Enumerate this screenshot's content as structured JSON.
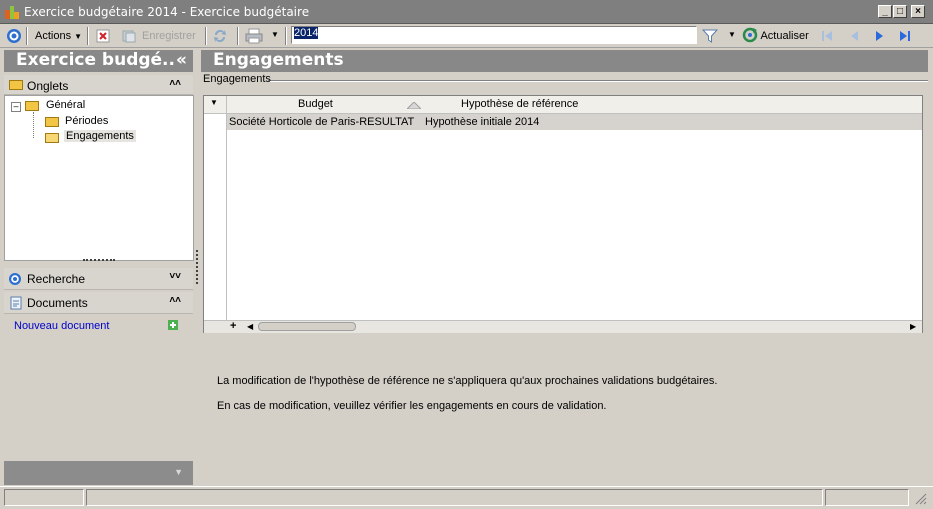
{
  "window": {
    "title": "Exercice budgétaire 2014 -  Exercice budgétaire",
    "minimize": "_",
    "maximize": "□",
    "close": "×"
  },
  "toolbar": {
    "actions_label": "Actions",
    "save_label": "Enregistrer",
    "search_value": "2014",
    "refresh_label": "Actualiser"
  },
  "left_panel": {
    "title": "Exercice budgé..",
    "collapse_glyph": "«",
    "tabs_section": "Onglets",
    "tree": {
      "root": "Général",
      "children": [
        "Périodes",
        "Engagements"
      ]
    },
    "search_section": "Recherche",
    "documents_section": "Documents",
    "new_document_link": "Nouveau document"
  },
  "main": {
    "title": "Engagements",
    "group_label": "Engagements",
    "grid": {
      "columns": [
        "Budget",
        "Hypothèse de référence"
      ],
      "rows": [
        [
          "Société Horticole de Paris-RESULTAT",
          "Hypothèse initiale 2014"
        ]
      ],
      "add_glyph": "+"
    },
    "messages": [
      "La modification de l'hypothèse de référence ne s'appliquera qu'aux prochaines validations budgétaires.",
      "En cas de modification, veuillez vérifier les engagements en cours de validation."
    ]
  },
  "colors": {
    "header_bar": "#888888",
    "selection": "#0a246a",
    "link": "#0000cc",
    "face": "#d4d0c8"
  }
}
